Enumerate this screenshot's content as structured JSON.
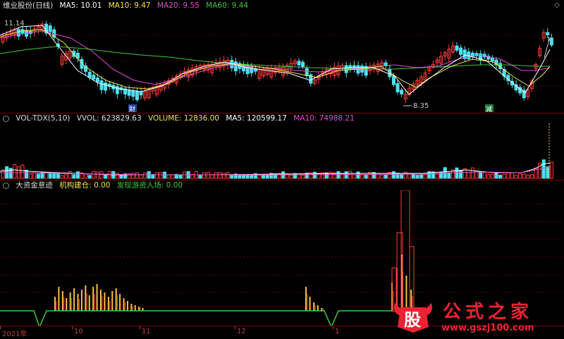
{
  "price_header": {
    "title": "维业股份(日线)",
    "ma5": "MA5: 10.01",
    "ma10": "MA10: 9.47",
    "ma20": "MA20: 9.55",
    "ma60": "MA60: 9.44"
  },
  "price_labels": {
    "high": "11.14",
    "low": "8.35",
    "marker1": "财",
    "marker2": "减"
  },
  "volume_header": {
    "title": "VOL-TDX(5,10)",
    "vvol": "VVOL: 623829.63",
    "volume": "VOLUME: 12836.00",
    "ma5": "MA5: 120599.17",
    "ma10": "MA10: 74988.21"
  },
  "indicator_header": {
    "title": "大资金意迹",
    "v1": "机构建仓: 0.00",
    "v2": "发现游资入场: 0.00"
  },
  "xaxis": {
    "ticks": [
      "2021年",
      "10",
      "11",
      "12",
      "1"
    ]
  },
  "watermark": {
    "logo_text": "股",
    "title": "公式之家",
    "url": "www.gszj100.com"
  },
  "colors": {
    "up": "#ff3b3b",
    "down": "#4ee0ee",
    "ma5": "#ffffff",
    "ma10": "#f5e14b",
    "ma20": "#e14bd8",
    "ma60": "#3ec83e",
    "grid": "#7a0000"
  },
  "icons": {
    "corner": "diamond-icon"
  }
}
